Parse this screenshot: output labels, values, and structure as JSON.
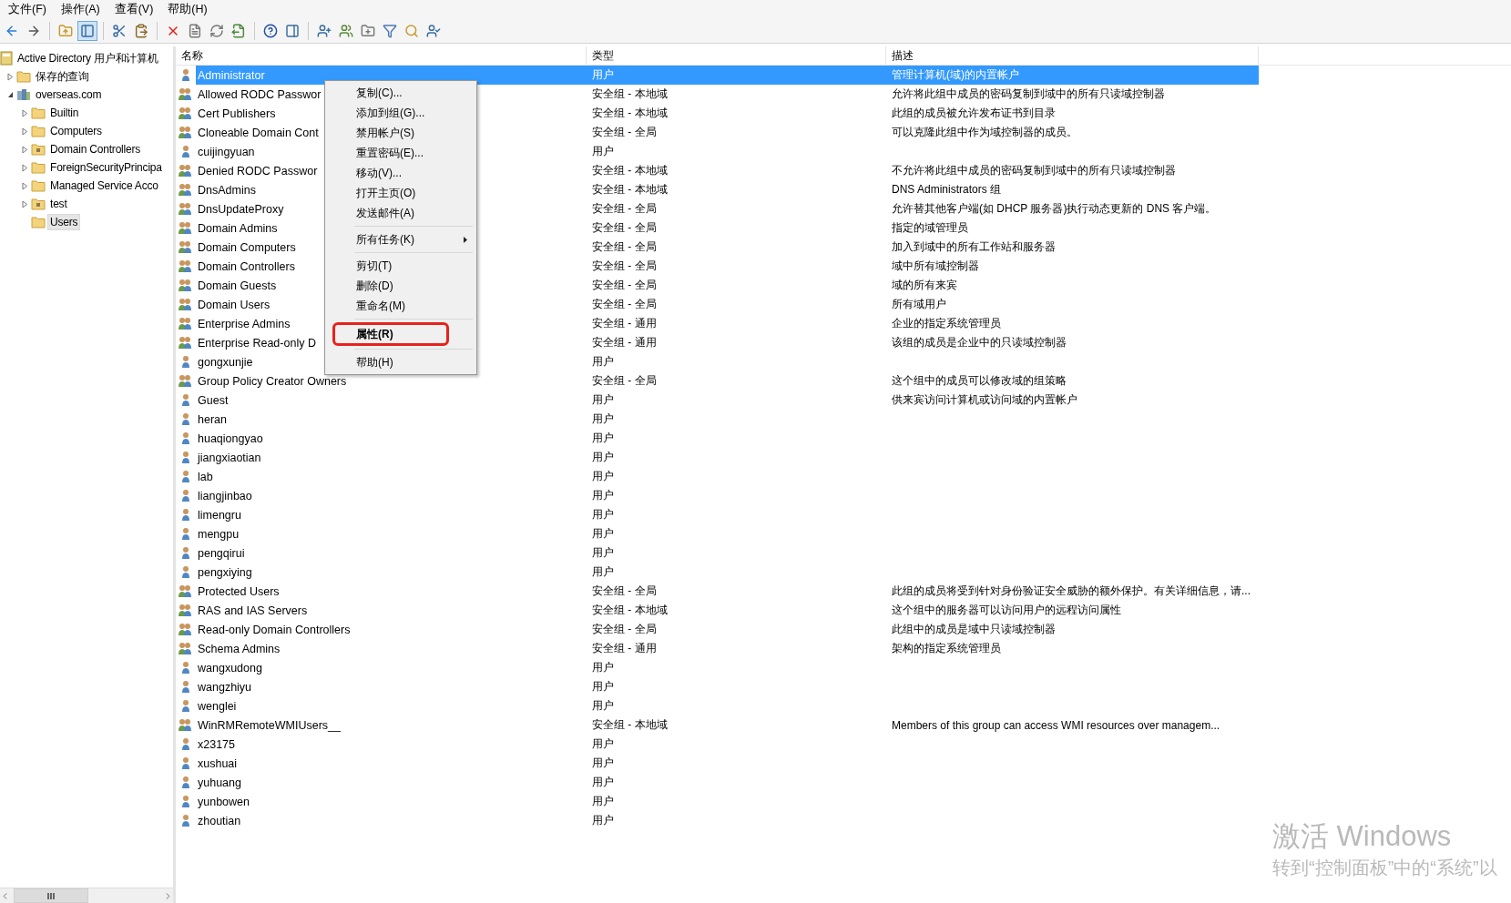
{
  "menu_bar": [
    "文件(F)",
    "操作(A)",
    "查看(V)",
    "帮助(H)"
  ],
  "toolbar_buttons": [
    {
      "pressed": false
    },
    {
      "pressed": false
    },
    {
      "pressed": false
    },
    {
      "pressed": true
    },
    {
      "pressed": false
    },
    {
      "pressed": false
    },
    {
      "pressed": false
    },
    {
      "pressed": false
    },
    {
      "pressed": false
    },
    {
      "pressed": false
    },
    {
      "pressed": false
    },
    {
      "pressed": false
    },
    {
      "pressed": false
    },
    {
      "pressed": false
    },
    {
      "pressed": false
    },
    {
      "pressed": false
    },
    {
      "pressed": false
    },
    {
      "pressed": false
    }
  ],
  "tree": {
    "label": "Active Directory 用户和计算机",
    "children": [
      {
        "label": "保存的查询",
        "kind": "folder",
        "expanded": false,
        "selected": false
      },
      {
        "label": "overseas.com",
        "kind": "domain",
        "expanded": true,
        "selected": false,
        "children": [
          {
            "label": "Builtin",
            "kind": "folder",
            "expanded": false,
            "selected": false
          },
          {
            "label": "Computers",
            "kind": "folder",
            "expanded": false,
            "selected": false
          },
          {
            "label": "Domain Controllers",
            "kind": "ou",
            "expanded": false,
            "selected": false
          },
          {
            "label": "ForeignSecurityPrincipa",
            "kind": "folder",
            "expanded": false,
            "selected": false
          },
          {
            "label": "Managed Service Acco",
            "kind": "folder",
            "expanded": false,
            "selected": false
          },
          {
            "label": "test",
            "kind": "ou",
            "expanded": false,
            "selected": false
          },
          {
            "label": "Users",
            "kind": "folder",
            "selected": true
          }
        ]
      }
    ]
  },
  "table": {
    "columns": [
      "名称",
      "类型",
      "描述"
    ],
    "rows": [
      {
        "kind": "user",
        "name": "Administrator",
        "type": "用户",
        "description": "管理计算机(域)的内置帐户",
        "selected": true
      },
      {
        "kind": "group",
        "name": "Allowed RODC Passwor",
        "type": "安全组 - 本地域",
        "description": "允许将此组中成员的密码复制到域中的所有只读域控制器",
        "selected": false
      },
      {
        "kind": "group",
        "name": "Cert Publishers",
        "type": "安全组 - 本地域",
        "description": "此组的成员被允许发布证书到目录",
        "selected": false
      },
      {
        "kind": "group",
        "name": "Cloneable Domain Cont",
        "type": "安全组 - 全局",
        "description": "可以克隆此组中作为域控制器的成员。",
        "selected": false
      },
      {
        "kind": "user",
        "name": "cuijingyuan",
        "type": "用户",
        "selected": false
      },
      {
        "kind": "group",
        "name": "Denied RODC Passwor",
        "type": "安全组 - 本地域",
        "description": "不允许将此组中成员的密码复制到域中的所有只读域控制器",
        "selected": false
      },
      {
        "kind": "group",
        "name": "DnsAdmins",
        "type": "安全组 - 本地域",
        "description": "DNS Administrators 组",
        "selected": false
      },
      {
        "kind": "group",
        "name": "DnsUpdateProxy",
        "type": "安全组 - 全局",
        "description": "允许替其他客户端(如 DHCP 服务器)执行动态更新的 DNS 客户端。",
        "selected": false
      },
      {
        "kind": "group",
        "name": "Domain Admins",
        "type": "安全组 - 全局",
        "description": "指定的域管理员",
        "selected": false
      },
      {
        "kind": "group",
        "name": "Domain Computers",
        "type": "安全组 - 全局",
        "description": "加入到域中的所有工作站和服务器",
        "selected": false
      },
      {
        "kind": "group",
        "name": "Domain Controllers",
        "type": "安全组 - 全局",
        "description": "域中所有域控制器",
        "selected": false
      },
      {
        "kind": "group",
        "name": "Domain Guests",
        "type": "安全组 - 全局",
        "description": "域的所有来宾",
        "selected": false
      },
      {
        "kind": "group",
        "name": "Domain Users",
        "type": "安全组 - 全局",
        "description": "所有域用户",
        "selected": false
      },
      {
        "kind": "group",
        "name": "Enterprise Admins",
        "type": "安全组 - 通用",
        "description": "企业的指定系统管理员",
        "selected": false
      },
      {
        "kind": "group",
        "name": "Enterprise Read-only D",
        "type": "安全组 - 通用",
        "description": "该组的成员是企业中的只读域控制器",
        "selected": false
      },
      {
        "kind": "user",
        "name": "gongxunjie",
        "type": "用户",
        "selected": false
      },
      {
        "kind": "group",
        "name": "Group Policy Creator Owners",
        "type": "安全组 - 全局",
        "description": "这个组中的成员可以修改域的组策略",
        "selected": false
      },
      {
        "kind": "user",
        "name": "Guest",
        "type": "用户",
        "description": "供来宾访问计算机或访问域的内置帐户",
        "selected": false
      },
      {
        "kind": "user",
        "name": "heran",
        "type": "用户",
        "selected": false
      },
      {
        "kind": "user",
        "name": "huaqiongyao",
        "type": "用户",
        "selected": false
      },
      {
        "kind": "user",
        "name": "jiangxiaotian",
        "type": "用户",
        "selected": false
      },
      {
        "kind": "user",
        "name": "lab",
        "type": "用户",
        "selected": false
      },
      {
        "kind": "user",
        "name": "liangjinbao",
        "type": "用户",
        "selected": false
      },
      {
        "kind": "user",
        "name": "limengru",
        "type": "用户",
        "selected": false
      },
      {
        "kind": "user",
        "name": "mengpu",
        "type": "用户",
        "selected": false
      },
      {
        "kind": "user",
        "name": "pengqirui",
        "type": "用户",
        "selected": false
      },
      {
        "kind": "user",
        "name": "pengxiying",
        "type": "用户",
        "selected": false
      },
      {
        "kind": "group",
        "name": "Protected Users",
        "type": "安全组 - 全局",
        "description": "此组的成员将受到针对身份验证安全威胁的额外保护。有关详细信息，请...",
        "selected": false
      },
      {
        "kind": "group",
        "name": "RAS and IAS Servers",
        "type": "安全组 - 本地域",
        "description": "这个组中的服务器可以访问用户的远程访问属性",
        "selected": false
      },
      {
        "kind": "group",
        "name": "Read-only Domain Controllers",
        "type": "安全组 - 全局",
        "description": "此组中的成员是域中只读域控制器",
        "selected": false
      },
      {
        "kind": "group",
        "name": "Schema Admins",
        "type": "安全组 - 通用",
        "description": "架构的指定系统管理员",
        "selected": false
      },
      {
        "kind": "user",
        "name": "wangxudong",
        "type": "用户",
        "selected": false
      },
      {
        "kind": "user",
        "name": "wangzhiyu",
        "type": "用户",
        "selected": false
      },
      {
        "kind": "user",
        "name": "wenglei",
        "type": "用户",
        "selected": false
      },
      {
        "kind": "group",
        "name": "WinRMRemoteWMIUsers__",
        "type": "安全组 - 本地域",
        "description": "Members of this group can access WMI resources over managem...",
        "selected": false
      },
      {
        "kind": "user",
        "name": "x23175",
        "type": "用户",
        "selected": false
      },
      {
        "kind": "user",
        "name": "xushuai",
        "type": "用户",
        "selected": false
      },
      {
        "kind": "user",
        "name": "yuhuang",
        "type": "用户",
        "selected": false
      },
      {
        "kind": "user",
        "name": "yunbowen",
        "type": "用户",
        "selected": false
      },
      {
        "kind": "user",
        "name": "zhoutian",
        "type": "用户",
        "selected": false
      }
    ]
  },
  "context_menu": [
    {
      "kind": "item",
      "label": "复制(C)...",
      "highlighted": false
    },
    {
      "kind": "item",
      "label": "添加到组(G)...",
      "highlighted": false
    },
    {
      "kind": "item",
      "label": "禁用帐户(S)",
      "highlighted": false
    },
    {
      "kind": "item",
      "label": "重置密码(E)...",
      "highlighted": false
    },
    {
      "kind": "item",
      "label": "移动(V)...",
      "highlighted": false
    },
    {
      "kind": "item",
      "label": "打开主页(O)",
      "highlighted": false
    },
    {
      "kind": "item",
      "label": "发送邮件(A)",
      "highlighted": false
    },
    {
      "kind": "separator"
    },
    {
      "kind": "submenu",
      "label": "所有任务(K)",
      "highlighted": false
    },
    {
      "kind": "separator"
    },
    {
      "kind": "item",
      "label": "剪切(T)",
      "highlighted": false
    },
    {
      "kind": "item",
      "label": "删除(D)",
      "highlighted": false
    },
    {
      "kind": "item",
      "label": "重命名(M)",
      "highlighted": false
    },
    {
      "kind": "separator"
    },
    {
      "kind": "item",
      "label": "属性(R)",
      "highlighted": true
    },
    {
      "kind": "separator"
    },
    {
      "kind": "item",
      "label": "帮助(H)",
      "highlighted": false
    }
  ],
  "activation_notice": {
    "title": "激活 Windows",
    "text": "转到“控制面板”中的“系统”以"
  }
}
